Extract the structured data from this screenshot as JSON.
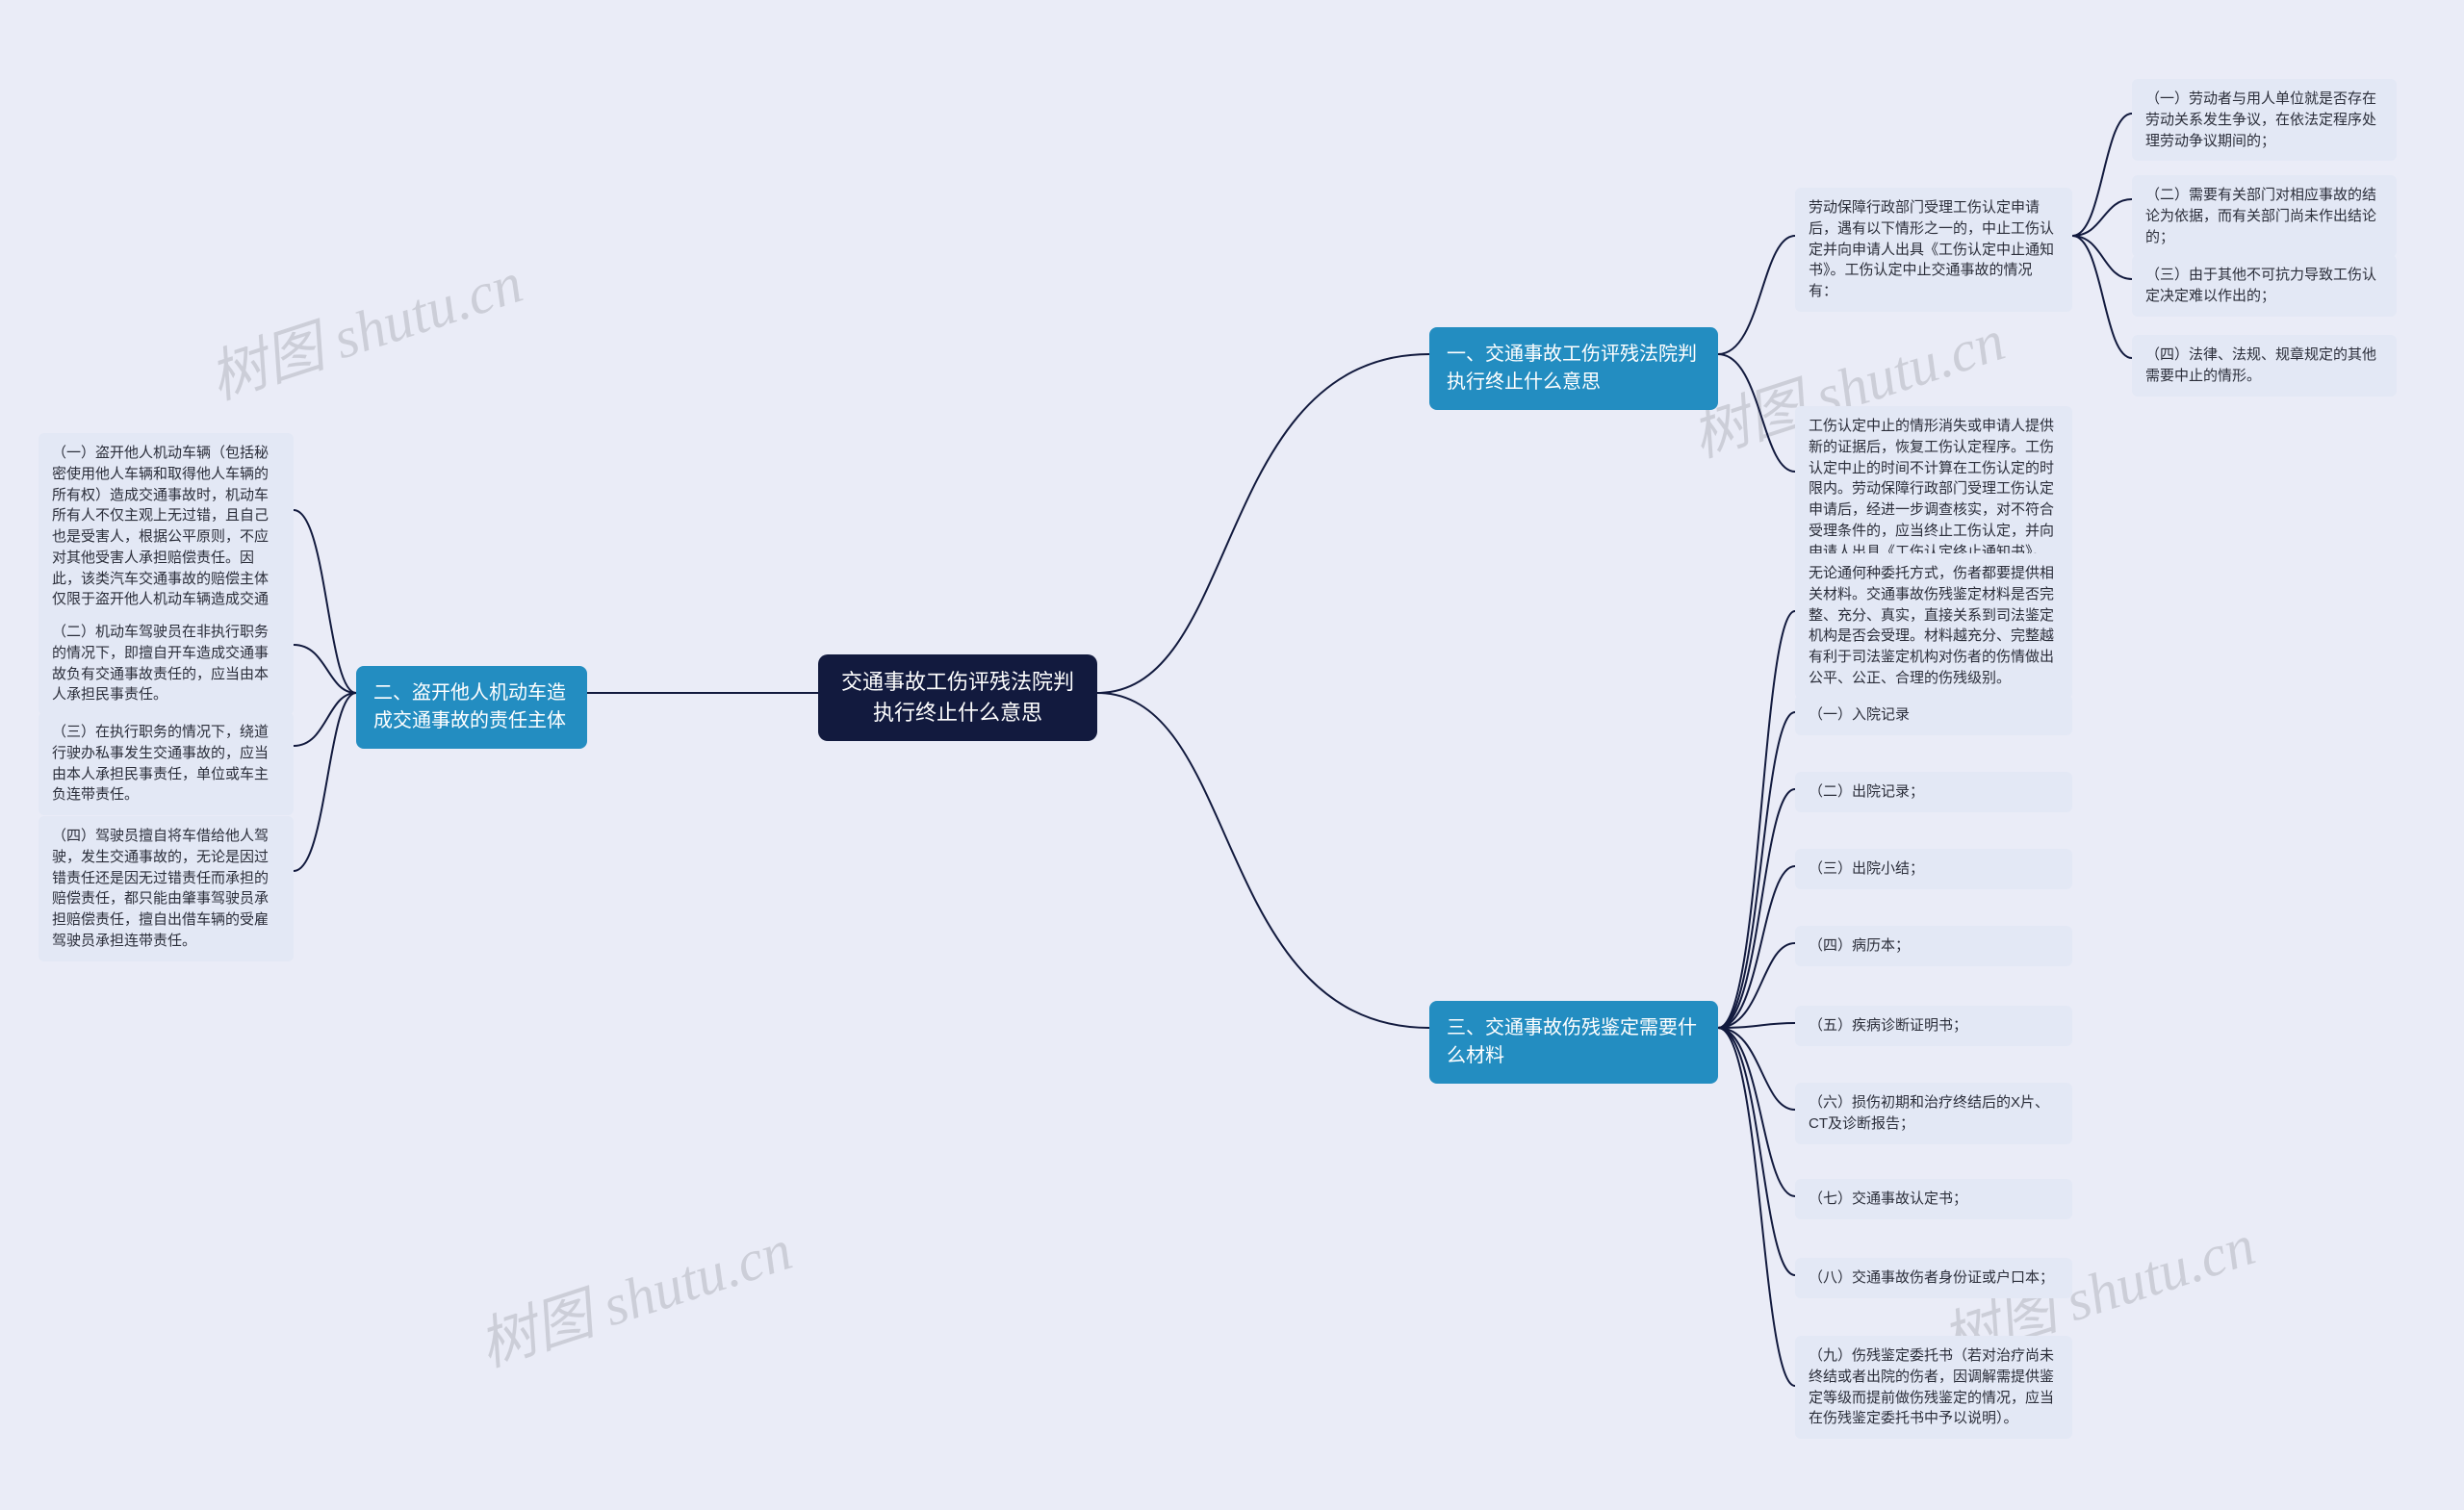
{
  "root": "交通事故工伤评残法院判执行终止什么意思",
  "branch_a": "一、交通事故工伤评残法院判执行终止什么意思",
  "branch_b": "二、盗开他人机动车造成交通事故的责任主体",
  "branch_c": "三、交通事故伤残鉴定需要什么材料",
  "a1": "劳动保障行政部门受理工伤认定申请后，遇有以下情形之一的，中止工伤认定并向申请人出具《工伤认定中止通知书》。工伤认定中止交通事故的情况有：",
  "a1_1": "（一）劳动者与用人单位就是否存在劳动关系发生争议，在依法定程序处理劳动争议期间的；",
  "a1_2": "（二）需要有关部门对相应事故的结论为依据，而有关部门尚未作出结论的；",
  "a1_3": "（三）由于其他不可抗力导致工伤认定决定难以作出的；",
  "a1_4": "（四）法律、法规、规章规定的其他需要中止的情形。",
  "a2": "工伤认定中止的情形消失或申请人提供新的证据后，恢复工伤认定程序。工伤认定中止的时间不计算在工伤认定的时限内。劳动保障行政部门受理工伤认定申请后，经进一步调查核实，对不符合受理条件的，应当终止工伤认定，并向申请人出具《工伤认定终止通知书》。",
  "b1": "（一）盗开他人机动车辆（包括秘密使用他人车辆和取得他人车辆的所有权）造成交通事故时，机动车所有人不仅主观上无过错，且自己也是受害人，根据公平原则，不应对其他受害人承担赔偿责任。因此，该类汽车交通事故的赔偿主体仅限于盗开他人机动车辆造成交通事故的人。",
  "b2": "（二）机动车驾驶员在非执行职务的情况下，即擅自开车造成交通事故负有交通事故责任的，应当由本人承担民事责任。",
  "b3": "（三）在执行职务的情况下，绕道行驶办私事发生交通事故的，应当由本人承担民事责任，单位或车主负连带责任。",
  "b4": "（四）驾驶员擅自将车借给他人驾驶，发生交通事故的，无论是因过错责任还是因无过错责任而承担的赔偿责任，都只能由肇事驾驶员承担赔偿责任，擅自出借车辆的受雇驾驶员承担连带责任。",
  "c0": "无论通何种委托方式，伤者都要提供相关材料。交通事故伤残鉴定材料是否完整、充分、真实，直接关系到司法鉴定机构是否会受理。材料越充分、完整越有利于司法鉴定机构对伤者的伤情做出公平、公正、合理的伤残级别。",
  "c1": "（一）入院记录",
  "c2": "（二）出院记录；",
  "c3": "（三）出院小结；",
  "c4": "（四）病历本；",
  "c5": "（五）疾病诊断证明书；",
  "c6": "（六）损伤初期和治疗终结后的X片、CT及诊断报告；",
  "c7": "（七）交通事故认定书；",
  "c8": "（八）交通事故伤者身份证或户口本；",
  "c9": "（九）伤残鉴定委托书（若对治疗尚未终结或者出院的伤者，因调解需提供鉴定等级而提前做伤残鉴定的情况，应当在伤残鉴定委托书中予以说明）。",
  "watermark": "树图 shutu.cn"
}
